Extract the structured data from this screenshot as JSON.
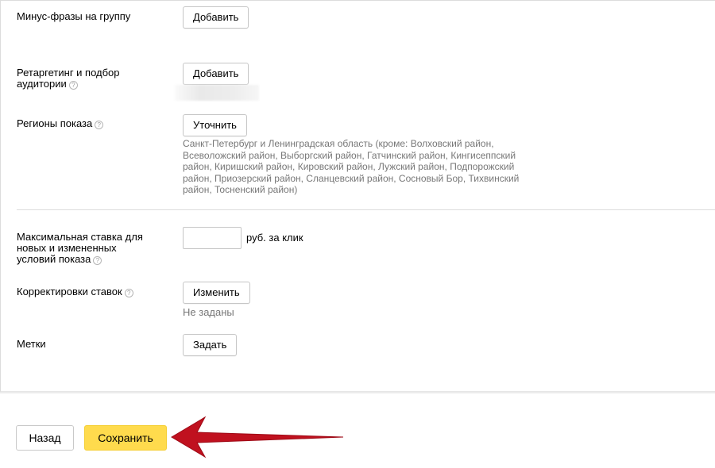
{
  "form": {
    "minus_phrases": {
      "label": "Минус-фразы на группу",
      "button": "Добавить"
    },
    "retargeting": {
      "label_line1": "Ретаргетинг и подбор",
      "label_line2": "аудитории",
      "button": "Добавить"
    },
    "regions": {
      "label": "Регионы показа",
      "button": "Уточнить",
      "lines": [
        "Санкт-Петербург и Ленинградская область (кроме: Волховский район,",
        "Всеволожский район, Выборгский район, Гатчинский район, Кингисеппский",
        "район, Киришский район, Кировский район, Лужский район, Подпорожский",
        "район, Приозерский район, Сланцевский район, Сосновый Бор, Тихвинский",
        "район, Тосненский район)"
      ]
    },
    "max_bid": {
      "label_line1": "Максимальная ставка для",
      "label_line2": "новых и измененных",
      "label_line3": "условий показа",
      "value": "",
      "unit": "руб. за клик"
    },
    "bid_adjustments": {
      "label": "Корректировки ставок",
      "button": "Изменить",
      "status": "Не заданы"
    },
    "tags": {
      "label": "Метки",
      "button": "Задать"
    }
  },
  "footer": {
    "back": "Назад",
    "save": "Сохранить"
  },
  "colors": {
    "save_button": "#ffdb4d",
    "arrow": "#c0111f",
    "help_icon": "#b5b5b5"
  },
  "icons": {
    "help": "help-icon",
    "arrow": "annotation-arrow"
  }
}
